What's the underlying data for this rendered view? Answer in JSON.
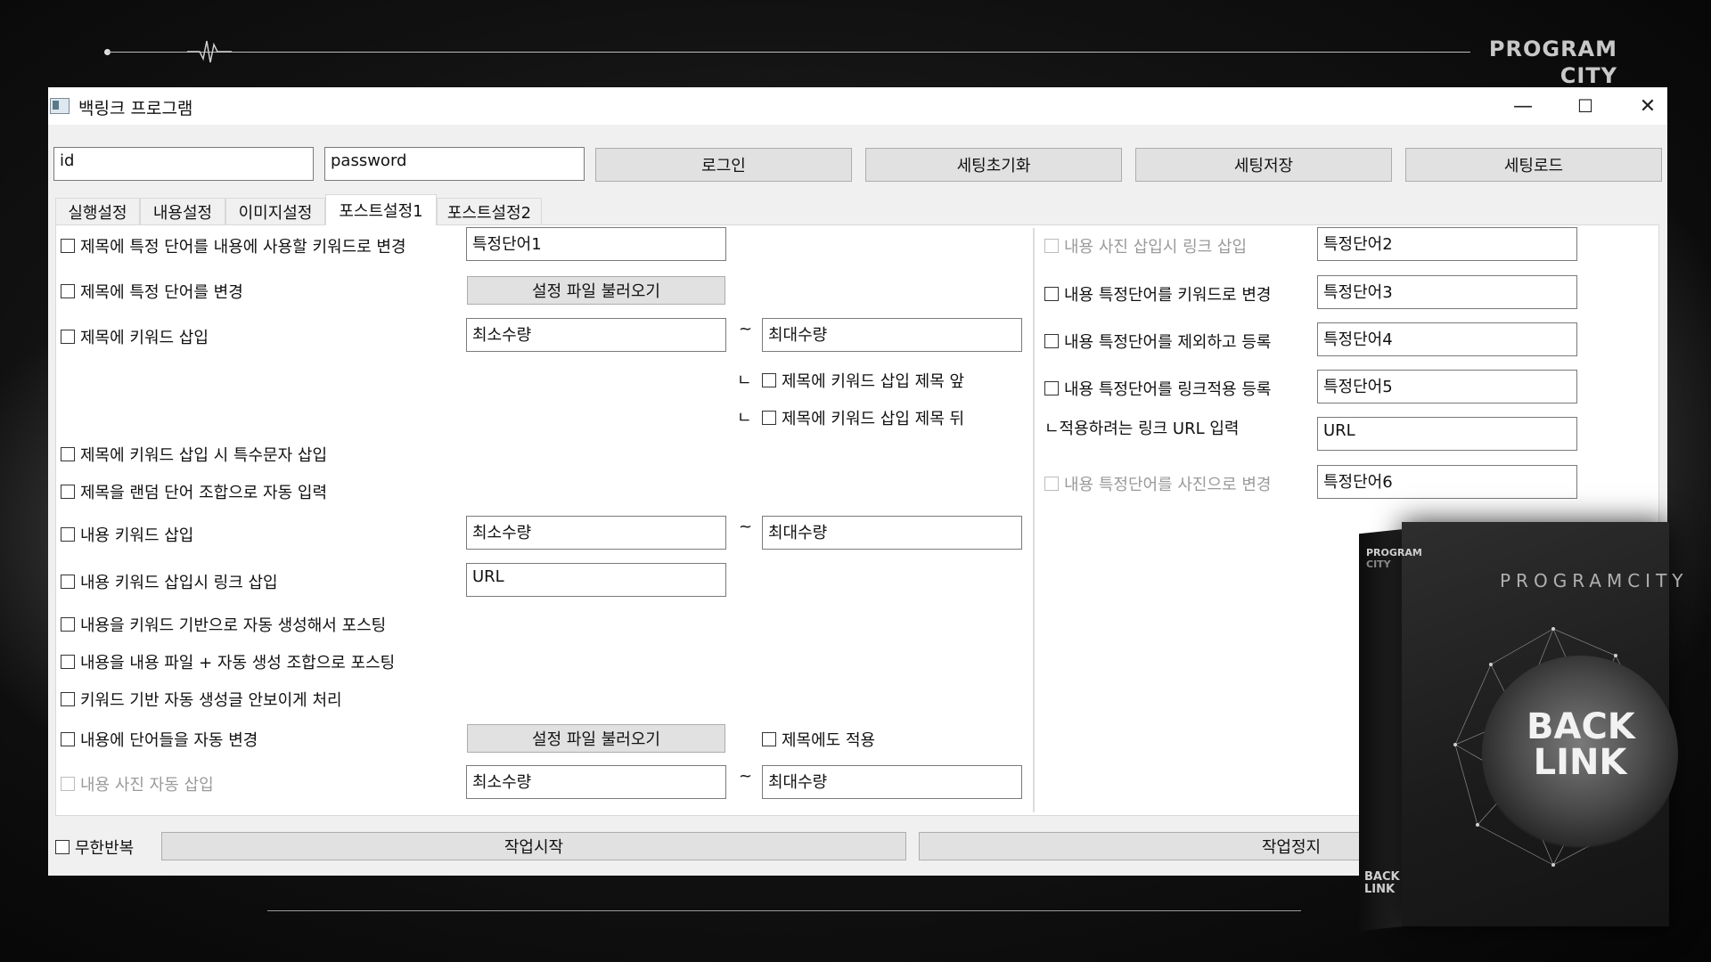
{
  "brand": {
    "line1": "PROGRAM",
    "line2": "CITY"
  },
  "window": {
    "title": "백링크 프로그램",
    "minimize": "—",
    "maximize": "☐",
    "close": "✕"
  },
  "login": {
    "id_value": "id",
    "password_value": "password",
    "login_button": "로그인",
    "reset_button": "세팅초기화",
    "save_button": "세팅저장",
    "load_button": "세팅로드"
  },
  "tabs": [
    "실행설정",
    "내용설정",
    "이미지설정",
    "포스트설정1",
    "포스트설정2"
  ],
  "active_tab": "포스트설정1",
  "left": {
    "title_keyword_change": {
      "label": "제목에 특정 단어를 내용에 사용할 키워드로 변경",
      "value": "특정단어1"
    },
    "title_word_change": {
      "label": "제목에 특정 단어를 변경",
      "button": "설정 파일 불러오기"
    },
    "title_keyword_insert": {
      "label": "제목에 키워드 삽입",
      "min": "최소수량",
      "tilde": "~",
      "max": "최대수량"
    },
    "title_insert_front": {
      "prefix": "ㄴ",
      "label": "제목에 키워드 삽입 제목 앞"
    },
    "title_insert_back": {
      "prefix": "ㄴ",
      "label": "제목에 키워드 삽입 제목 뒤"
    },
    "title_special_char": "제목에 키워드 삽입 시 특수문자 삽입",
    "title_random": "제목을 랜덤 단어 조합으로 자동 입력",
    "content_keyword_insert": {
      "label": "내용 키워드 삽입",
      "min": "최소수량",
      "tilde": "~",
      "max": "최대수량"
    },
    "content_keyword_link": {
      "label": "내용 키워드 삽입시 링크 삽입",
      "value": "URL"
    },
    "content_auto_generate": "내용을 키워드 기반으로 자동 생성해서 포스팅",
    "content_file_combo": "내용을 내용 파일 + 자동 생성 조합으로 포스팅",
    "hide_generated": "키워드 기반 자동 생성글 안보이게 처리",
    "content_word_change": {
      "label": "내용에 단어들을 자동 변경",
      "button": "설정 파일 불러오기",
      "apply_title": "제목에도 적용"
    },
    "content_photo_insert": {
      "label": "내용 사진 자동 삽입",
      "min": "최소수량",
      "tilde": "~",
      "max": "최대수량"
    }
  },
  "right": {
    "photo_link": {
      "label": "내용 사진 삽입시 링크 삽입",
      "value": "특정단어2"
    },
    "to_keyword": {
      "label": "내용 특정단어를 키워드로 변경",
      "value": "특정단어3"
    },
    "exclude": {
      "label": "내용 특정단어를 제외하고 등록",
      "value": "특정단어4"
    },
    "link_apply": {
      "label": "내용 특정단어를 링크적용 등록",
      "value": "특정단어5"
    },
    "link_url": {
      "label": "ㄴ적용하려는 링크 URL 입력",
      "value": "URL"
    },
    "to_photo": {
      "label": "내용 특정단어를 사진으로 변경",
      "value": "특정단어6"
    }
  },
  "footer": {
    "infinite_repeat": "무한반복",
    "start_button": "작업시작",
    "stop_button": "작업정지"
  },
  "product_box": {
    "side_brand_1": "PROGRAM",
    "side_brand_2": "CITY",
    "front_title": "PROGRAMCITY",
    "logo_1": "BACK",
    "logo_2": "LINK",
    "side_logo_1": "BACK",
    "side_logo_2": "LINK"
  }
}
